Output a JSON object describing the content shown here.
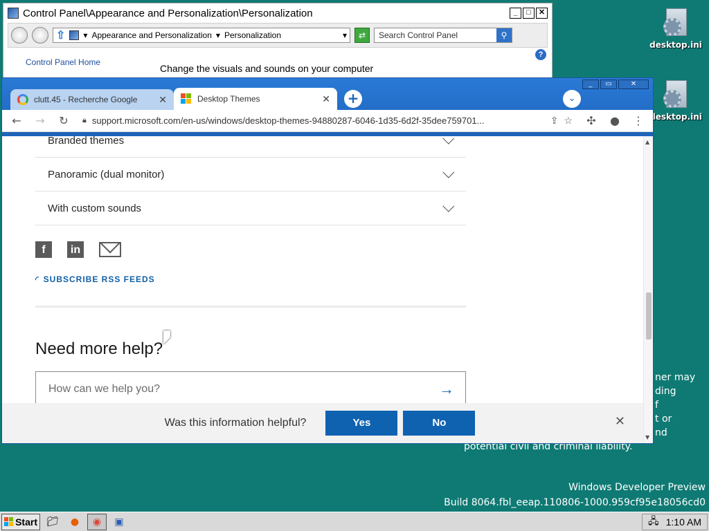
{
  "desktop": {
    "icons": [
      {
        "label": "desktop.ini"
      },
      {
        "label": "desktop.ini"
      }
    ],
    "behind_text": [
      "ner may",
      "ding",
      "f",
      "t or",
      "nd",
      "potential civil and criminal liability."
    ],
    "watermark": {
      "line1": "Windows Developer Preview",
      "line2": "Build 8064.fbl_eeap.110806-1000.959cf95e18056cd0"
    }
  },
  "control_panel": {
    "title": "Control Panel\\Appearance and Personalization\\Personalization",
    "breadcrumb_1": "Appearance and Personalization",
    "breadcrumb_2": "Personalization",
    "search_placeholder": "Search Control Panel",
    "home_link": "Control Panel Home",
    "heading": "Change the visuals and sounds on your computer",
    "help_icon": "?"
  },
  "browser": {
    "tabs": [
      {
        "title": "clutt.45 - Recherche Google",
        "favicon": "google-icon"
      },
      {
        "title": "Desktop Themes",
        "favicon": "microsoft-icon"
      }
    ],
    "url": "support.microsoft.com/en-us/windows/desktop-themes-94880287-6046-1d35-6d2f-35dee759701...",
    "page": {
      "accordion": [
        "Branded themes",
        "Panoramic (dual monitor)",
        "With custom sounds"
      ],
      "rss": "SUBSCRIBE RSS FEEDS",
      "need_help": "Need more help?",
      "help_placeholder": "How can we help you?",
      "feedback_question": "Was this information helpful?",
      "yes": "Yes",
      "no": "No"
    }
  },
  "taskbar": {
    "start": "Start",
    "time": "1:10 AM"
  },
  "colors": {
    "desktop": "#0f7a74",
    "accent": "#0f62b0",
    "chrome_frame": "#1e64b8"
  }
}
